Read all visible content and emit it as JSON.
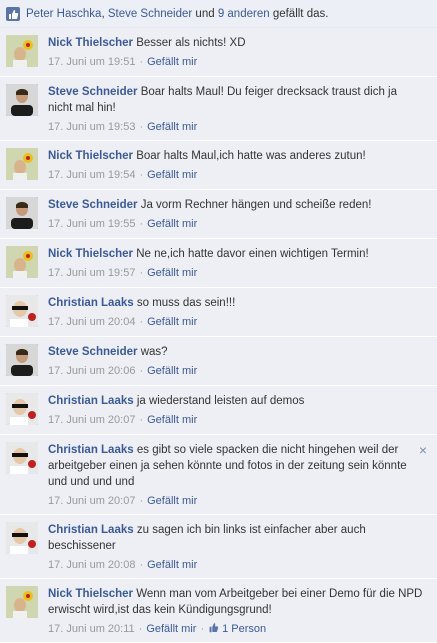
{
  "likes_bar": {
    "user1": "Peter Haschka",
    "user2": "Steve Schneider",
    "connector": "und",
    "others": "9 anderen",
    "suffix": "gefällt das."
  },
  "comments": [
    {
      "name": "Nick Thielscher",
      "text": "Besser als nichts! XD",
      "time": "17. Juni um 19:51",
      "like": "Gefällt mir"
    },
    {
      "name": "Steve Schneider",
      "text": "Boar halts Maul! Du feiger drecksack traust dich ja nicht mal hin!",
      "time": "17. Juni um 19:53",
      "like": "Gefällt mir"
    },
    {
      "name": "Nick Thielscher",
      "text": "Boar halts Maul,ich hatte was anderes zutun!",
      "time": "17. Juni um 19:54",
      "like": "Gefällt mir"
    },
    {
      "name": "Steve Schneider",
      "text": "Ja vorm Rechner hängen und scheiße reden!",
      "time": "17. Juni um 19:55",
      "like": "Gefällt mir"
    },
    {
      "name": "Nick Thielscher",
      "text": "Ne ne,ich hatte davor einen wichtigen Termin!",
      "time": "17. Juni um 19:57",
      "like": "Gefällt mir"
    },
    {
      "name": "Christian Laaks",
      "text": "so muss das sein!!!",
      "time": "17. Juni um 20:04",
      "like": "Gefällt mir"
    },
    {
      "name": "Steve Schneider",
      "text": "was?",
      "time": "17. Juni um 20:06",
      "like": "Gefällt mir"
    },
    {
      "name": "Christian Laaks",
      "text": "ja wiederstand leisten auf demos",
      "time": "17. Juni um 20:07",
      "like": "Gefällt mir"
    },
    {
      "name": "Christian Laaks",
      "text": "es gibt so viele spacken die nicht hingehen weil der arbeitgeber einen ja sehen könnte und fotos in der zeitung sein könnte und und und und",
      "time": "17. Juni um 20:07",
      "like": "Gefällt mir"
    },
    {
      "name": "Christian Laaks",
      "text": "zu sagen ich bin links ist einfacher aber auch beschissener",
      "time": "17. Juni um 20:08",
      "like": "Gefällt mir"
    },
    {
      "name": "Nick Thielscher",
      "text": "Wenn man vom Arbeitgeber bei einer Demo für die NPD erwischt wird,ist das kein Kündigungsgrund!",
      "time": "17. Juni um 20:11",
      "like": "Gefällt mir",
      "like_count": "1 Person"
    }
  ],
  "close_glyph": "×",
  "colors": {
    "link": "#3b5998",
    "bg": "#edeff4",
    "meta": "#999999"
  }
}
